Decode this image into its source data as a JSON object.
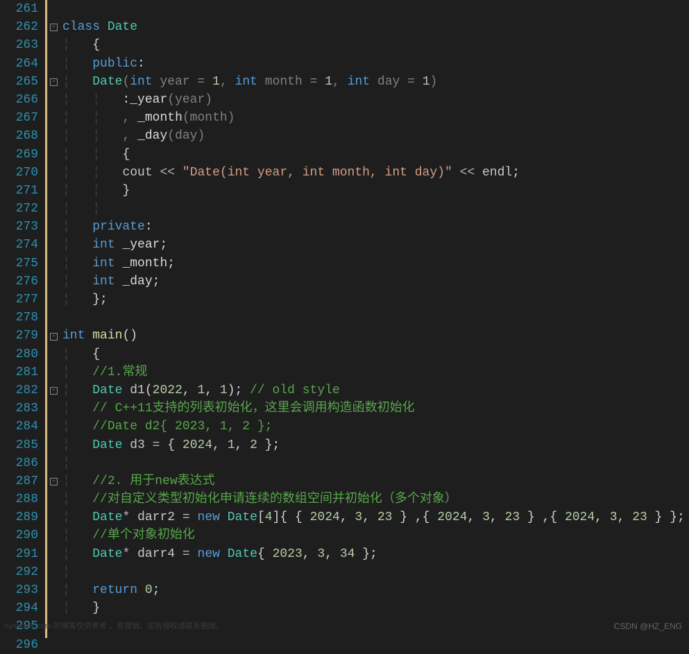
{
  "line_start": 261,
  "line_end": 296,
  "fold_markers": [
    262,
    265,
    279,
    282,
    287
  ],
  "code_lines": [
    {
      "n": 261,
      "html": ""
    },
    {
      "n": 262,
      "html": "<span class='kw'>class</span> <span class='type'>Date</span>"
    },
    {
      "n": 263,
      "html": "{"
    },
    {
      "n": 264,
      "html": "<span class='kw'>public</span>:"
    },
    {
      "n": 265,
      "html": "    <span class='type'>Date</span><span class='gray'>(</span><span class='kw'>int</span> <span class='gray'>year</span> <span class='gray'>=</span> <span class='num'>1</span><span class='gray'>,</span> <span class='kw'>int</span> <span class='gray'>month</span> <span class='gray'>=</span> <span class='num'>1</span><span class='gray'>,</span> <span class='kw'>int</span> <span class='gray'>day</span> <span class='gray'>=</span> <span class='num'>1</span><span class='gray'>)</span>"
    },
    {
      "n": 266,
      "html": "        :<span class='field'>_year</span><span class='gray'>(year)</span>"
    },
    {
      "n": 267,
      "html": "        <span class='gray'>,</span> <span class='field'>_month</span><span class='gray'>(month)</span>"
    },
    {
      "n": 268,
      "html": "        <span class='gray'>,</span> <span class='field'>_day</span><span class='gray'>(day)</span>"
    },
    {
      "n": 269,
      "html": "    {"
    },
    {
      "n": 270,
      "html": "        <span class='var'>cout</span> <span class='op'>&lt;&lt;</span> <span class='str'>\"Date(int year, int month, int day)\"</span> <span class='op'>&lt;&lt;</span> <span class='var'>endl</span>;"
    },
    {
      "n": 271,
      "html": "    }"
    },
    {
      "n": 272,
      "html": ""
    },
    {
      "n": 273,
      "html": "<span class='kw'>private</span>:"
    },
    {
      "n": 274,
      "html": "    <span class='kw'>int</span> <span class='field'>_year</span>;"
    },
    {
      "n": 275,
      "html": "    <span class='kw'>int</span> <span class='field'>_month</span>;"
    },
    {
      "n": 276,
      "html": "    <span class='kw'>int</span> <span class='field'>_day</span>;"
    },
    {
      "n": 277,
      "html": "};"
    },
    {
      "n": 278,
      "html": ""
    },
    {
      "n": 279,
      "html": "<span class='kw'>int</span> <span class='func'>main</span>()"
    },
    {
      "n": 280,
      "html": "{"
    },
    {
      "n": 281,
      "html": "    <span class='cmt'>//1.常规</span>"
    },
    {
      "n": 282,
      "html": "    <span class='type'>Date</span> <span class='var'>d1</span>(<span class='num'>2022</span>, <span class='num'>1</span>, <span class='num'>1</span>); <span class='cmt'>// old style</span>"
    },
    {
      "n": 283,
      "html": "    <span class='cmt'>// C++11支持的列表初始化，这里会调用构造函数初始化</span>"
    },
    {
      "n": 284,
      "html": "    <span class='cmt'>//Date d2{ 2023, 1, 2 };</span>"
    },
    {
      "n": 285,
      "html": "    <span class='type'>Date</span> <span class='var'>d3</span> <span class='op'>=</span> { <span class='num'>2024</span>, <span class='num'>1</span>, <span class='num'>2</span> };"
    },
    {
      "n": 286,
      "html": ""
    },
    {
      "n": 287,
      "html": "    <span class='cmt'>//2. 用于new表达式</span>"
    },
    {
      "n": 288,
      "html": "    <span class='cmt'>//对自定义类型初始化申请连续的数组空间并初始化（多个对象）</span>"
    },
    {
      "n": 289,
      "html": "    <span class='type'>Date</span><span class='op'>*</span> <span class='var'>darr2</span> <span class='op'>=</span> <span class='kw'>new</span> <span class='type'>Date</span>[<span class='num'>4</span>]{ { <span class='num'>2024</span>, <span class='num'>3</span>, <span class='num'>23</span> } ,{ <span class='num'>2024</span>, <span class='num'>3</span>, <span class='num'>23</span> } ,{ <span class='num'>2024</span>, <span class='num'>3</span>, <span class='num'>23</span> } };"
    },
    {
      "n": 290,
      "html": "    <span class='cmt'>//单个对象初始化</span>"
    },
    {
      "n": 291,
      "html": "    <span class='type'>Date</span><span class='op'>*</span> <span class='var'>darr4</span> <span class='op'>=</span> <span class='kw'>new</span> <span class='type'>Date</span>{ <span class='num'>2023</span>, <span class='num'>3</span>, <span class='num'>34</span> };"
    },
    {
      "n": 292,
      "html": ""
    },
    {
      "n": 293,
      "html": "    <span class='kw'>return</span> <span class='num'>0</span>;"
    },
    {
      "n": 294,
      "html": "}"
    },
    {
      "n": 295,
      "html": ""
    },
    {
      "n": 296,
      "html": ""
    }
  ],
  "indent_guides": {
    "263": 1,
    "264": 1,
    "265": 1,
    "266": 2,
    "267": 2,
    "268": 2,
    "269": 2,
    "270": 2,
    "271": 2,
    "272": 2,
    "273": 1,
    "274": 1,
    "275": 1,
    "276": 1,
    "277": 1,
    "280": 1,
    "281": 1,
    "282": 1,
    "283": 1,
    "284": 1,
    "285": 1,
    "286": 1,
    "287": 1,
    "288": 1,
    "289": 1,
    "290": 1,
    "291": 1,
    "292": 1,
    "293": 1,
    "294": 1
  },
  "watermark_right": "CSDN @HZ_ENG",
  "watermark_left": "nynetsec.com 的博客仅供参考 、非营销、如有侵权请联系删除。"
}
